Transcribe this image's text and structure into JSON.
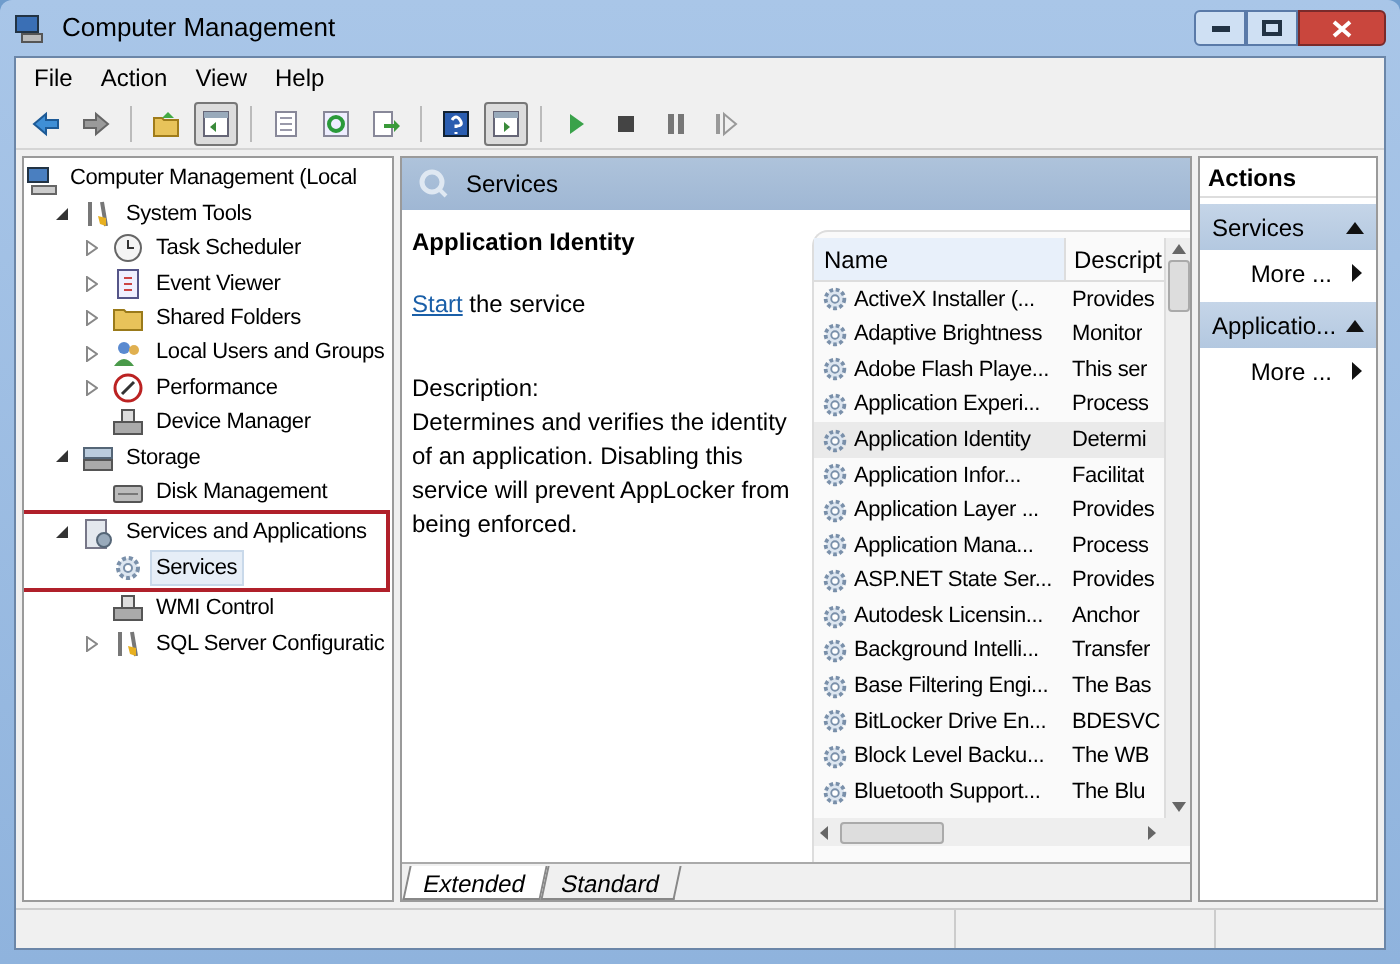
{
  "window": {
    "title": "Computer Management"
  },
  "menu": [
    "File",
    "Action",
    "View",
    "Help"
  ],
  "toolbar": [
    {
      "kind": "back",
      "pressed": false
    },
    {
      "kind": "forward",
      "pressed": false
    },
    {
      "kind": "sep"
    },
    {
      "kind": "up",
      "pressed": false
    },
    {
      "kind": "panel",
      "pressed": true
    },
    {
      "kind": "sep"
    },
    {
      "kind": "list",
      "pressed": false
    },
    {
      "kind": "refresh",
      "pressed": false
    },
    {
      "kind": "export",
      "pressed": false
    },
    {
      "kind": "sep"
    },
    {
      "kind": "help",
      "pressed": false
    },
    {
      "kind": "panel2",
      "pressed": true
    },
    {
      "kind": "sep"
    },
    {
      "kind": "play",
      "pressed": false
    },
    {
      "kind": "stop",
      "pressed": false
    },
    {
      "kind": "pause",
      "pressed": false
    },
    {
      "kind": "resume",
      "pressed": false
    }
  ],
  "tree": [
    {
      "label": "Computer Management (Local",
      "children": [
        {
          "label": "System Tools",
          "expanded": true,
          "children": [
            {
              "label": "Task Scheduler",
              "expanded": false
            },
            {
              "label": "Event Viewer",
              "expanded": false
            },
            {
              "label": "Shared Folders",
              "expanded": false
            },
            {
              "label": "Local Users and Groups",
              "expanded": false
            },
            {
              "label": "Performance",
              "expanded": false
            },
            {
              "label": "Device Manager"
            }
          ]
        },
        {
          "label": "Storage",
          "expanded": true,
          "children": [
            {
              "label": "Disk Management"
            }
          ]
        },
        {
          "label": "Services and Applications",
          "expanded": true,
          "marked": true,
          "children": [
            {
              "label": "Services",
              "selected": true
            },
            {
              "label": "WMI Control"
            },
            {
              "label": "SQL Server Configuratic",
              "expanded": false
            }
          ]
        }
      ]
    }
  ],
  "details": {
    "header": "Services",
    "title": "Application Identity",
    "link": "Start",
    "link_rest": " the service",
    "description_label": "Description:",
    "description": "Determines and verifies the identity of an application. Disabling this service will prevent AppLocker from being enforced."
  },
  "table": {
    "columns": [
      "Name",
      "Descript"
    ],
    "rows": [
      {
        "name": "ActiveX Installer (...",
        "description": "Provides",
        "selected": false
      },
      {
        "name": "Adaptive Brightness",
        "description": "Monitor",
        "selected": false
      },
      {
        "name": "Adobe Flash Playe...",
        "description": "This ser",
        "selected": false
      },
      {
        "name": "Application Experi...",
        "description": "Process",
        "selected": false
      },
      {
        "name": "Application Identity",
        "description": "Determi",
        "selected": true
      },
      {
        "name": "Application Infor...",
        "description": "Facilitat",
        "selected": false
      },
      {
        "name": "Application Layer ...",
        "description": "Provides",
        "selected": false
      },
      {
        "name": "Application Mana...",
        "description": "Process",
        "selected": false
      },
      {
        "name": "ASP.NET State Ser...",
        "description": "Provides",
        "selected": false
      },
      {
        "name": "Autodesk Licensin...",
        "description": "Anchor",
        "selected": false
      },
      {
        "name": "Background Intelli...",
        "description": "Transfer",
        "selected": false
      },
      {
        "name": "Base Filtering Engi...",
        "description": "The Bas",
        "selected": false
      },
      {
        "name": "BitLocker Drive En...",
        "description": "BDESVC",
        "selected": false
      },
      {
        "name": "Block Level Backu...",
        "description": "The WB",
        "selected": false
      },
      {
        "name": "Bluetooth Support...",
        "description": "The Blu",
        "selected": false
      }
    ]
  },
  "view_tabs": [
    {
      "label": "Extended",
      "selected": true
    },
    {
      "label": "Standard",
      "selected": false
    }
  ],
  "actions": {
    "title": "Actions",
    "sections": [
      {
        "title": "Services",
        "item": "More ..."
      },
      {
        "title": "Applicatio...",
        "item": "More ..."
      }
    ]
  }
}
